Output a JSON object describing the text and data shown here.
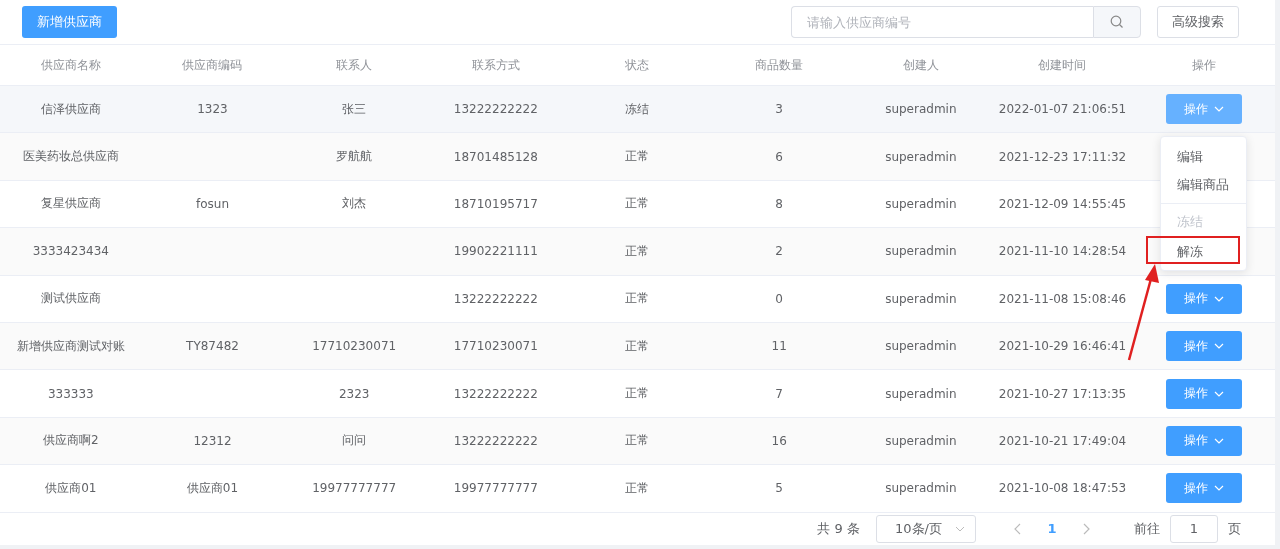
{
  "toolbar": {
    "add_button": "新增供应商",
    "search": {
      "placeholder": "请输入供应商编号"
    },
    "advanced_button": "高级搜索"
  },
  "table": {
    "columns": [
      "供应商名称",
      "供应商编码",
      "联系人",
      "联系方式",
      "状态",
      "商品数量",
      "创建人",
      "创建时间",
      "操作"
    ],
    "rows": [
      {
        "cells": [
          "信泽供应商",
          "1323",
          "张三",
          "13222222222",
          "冻结",
          "3",
          "superadmin",
          "2022-01-07 21:06:51"
        ],
        "action": "操作",
        "highlighted": true
      },
      {
        "cells": [
          "医美药妆总供应商",
          "",
          "罗航航",
          "18701485128",
          "正常",
          "6",
          "superadmin",
          "2021-12-23 17:11:32"
        ],
        "highlighted": false
      },
      {
        "cells": [
          "复星供应商",
          "fosun",
          "刘杰",
          "18710195717",
          "正常",
          "8",
          "superadmin",
          "2021-12-09 14:55:45"
        ],
        "highlighted": false
      },
      {
        "cells": [
          "3333423434",
          "",
          "",
          "19902221111",
          "正常",
          "2",
          "superadmin",
          "2021-11-10 14:28:54"
        ],
        "highlighted": false
      },
      {
        "cells": [
          "测试供应商",
          "",
          "",
          "13222222222",
          "正常",
          "0",
          "superadmin",
          "2021-11-08 15:08:46"
        ],
        "action": "操作",
        "highlighted": false
      },
      {
        "cells": [
          "新增供应商测试对账",
          "TY87482",
          "17710230071",
          "17710230071",
          "正常",
          "11",
          "superadmin",
          "2021-10-29 16:46:41"
        ],
        "action": "操作",
        "highlighted": false
      },
      {
        "cells": [
          "333333",
          "",
          "2323",
          "13222222222",
          "正常",
          "7",
          "superadmin",
          "2021-10-27 17:13:35"
        ],
        "action": "操作",
        "highlighted": false
      },
      {
        "cells": [
          "供应商啊2",
          "12312",
          "问问",
          "13222222222",
          "正常",
          "16",
          "superadmin",
          "2021-10-21 17:49:04"
        ],
        "action": "操作",
        "highlighted": false
      },
      {
        "cells": [
          "供应商01",
          "供应商01",
          "19977777777",
          "19977777777",
          "正常",
          "5",
          "superadmin",
          "2021-10-08 18:47:53"
        ],
        "action": "操作",
        "highlighted": false
      }
    ]
  },
  "dropdown": {
    "items": [
      {
        "label": "编辑",
        "disabled": false,
        "divided": false,
        "annotated": false
      },
      {
        "label": "编辑商品",
        "disabled": false,
        "divided": false,
        "annotated": false
      },
      {
        "label": "冻结",
        "disabled": true,
        "divided": true,
        "annotated": false
      },
      {
        "label": "解冻",
        "disabled": false,
        "divided": false,
        "annotated": true
      }
    ]
  },
  "pagination": {
    "total": "共 9 条",
    "page_size": "10条/页",
    "pages": [
      {
        "label": "1",
        "selected": true
      }
    ],
    "goto_label": "前往",
    "goto_value": "1",
    "page_suffix": "页"
  }
}
